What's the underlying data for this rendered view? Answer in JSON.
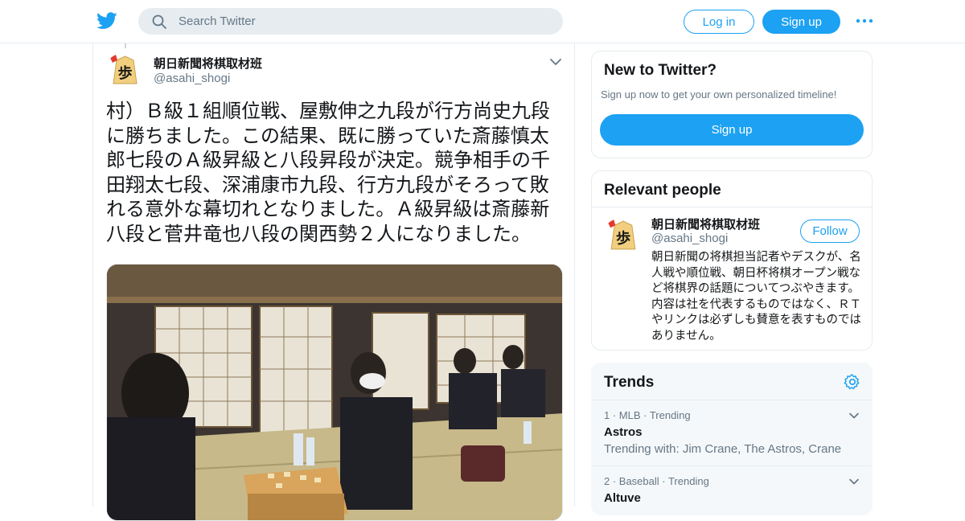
{
  "header": {
    "search_placeholder": "Search Twitter",
    "login_label": "Log in",
    "signup_label": "Sign up"
  },
  "tweet": {
    "display_name": "朝日新聞将棋取材班",
    "handle": "@asahi_shogi",
    "text": "村）Ｂ級１組順位戦、屋敷伸之九段が行方尚史九段に勝ちました。この結果、既に勝っていた斎藤慎太郎七段のＡ級昇級と八段昇段が決定。競争相手の千田翔太七段、深浦康市九段、行方九段がそろって敗れる意外な幕切れとなりました。Ａ級昇級は斎藤新八段と菅井竜也八段の関西勢２人になりました。"
  },
  "new_to_twitter": {
    "title": "New to Twitter?",
    "subtitle": "Sign up now to get your own personalized timeline!",
    "signup_label": "Sign up"
  },
  "relevant_people": {
    "title": "Relevant people",
    "person": {
      "name": "朝日新聞将棋取材班",
      "handle": "@asahi_shogi",
      "follow_label": "Follow",
      "bio": "朝日新聞の将棋担当記者やデスクが、名人戦や順位戦、朝日杯将棋オープン戦など将棋界の話題についてつぶやきます。内容は社を代表するものではなく、ＲＴやリンクは必ずしも賛意を表すものではありません。"
    }
  },
  "trends": {
    "title": "Trends",
    "items": [
      {
        "meta": "1 · MLB · Trending",
        "name": "Astros",
        "with": "Trending with: Jim Crane, The Astros, Crane"
      },
      {
        "meta": "2 · Baseball · Trending",
        "name": "Altuve",
        "with": ""
      }
    ]
  },
  "colors": {
    "accent": "#1da1f2",
    "muted": "#657786",
    "border": "#e6ecf0",
    "search_bg": "#e6ecf0",
    "trends_bg": "#f5f8fa"
  },
  "icons": [
    "twitter-bird-icon",
    "search-icon",
    "more-dots-icon",
    "chevron-down-icon",
    "gear-icon"
  ]
}
